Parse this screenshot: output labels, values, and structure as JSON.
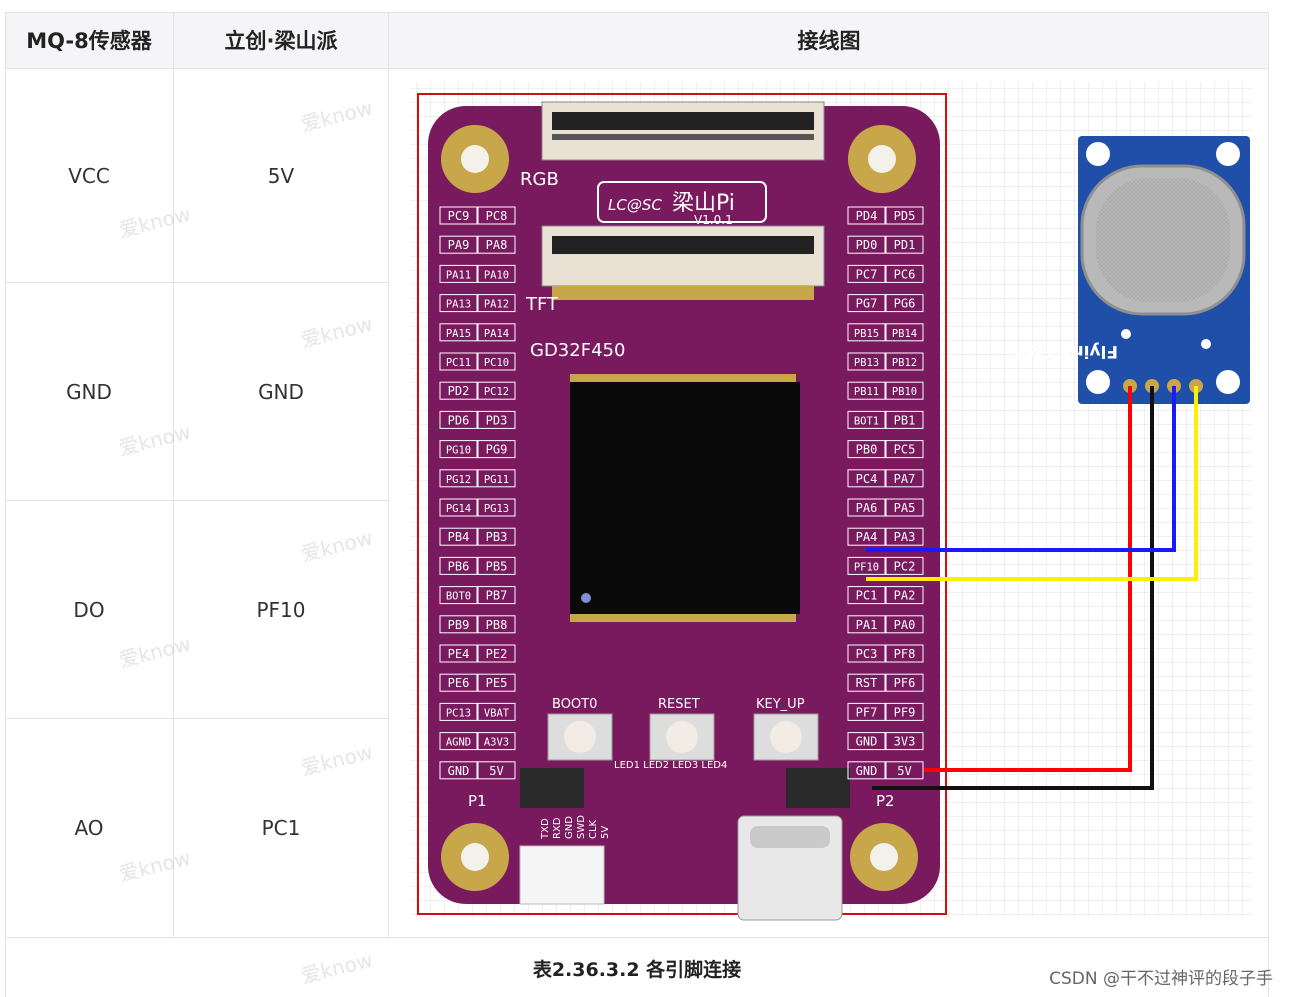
{
  "table": {
    "headers": [
      "MQ-8传感器",
      "立创·梁山派",
      "接线图"
    ],
    "rows": [
      {
        "sensor": "VCC",
        "board": "5V"
      },
      {
        "sensor": "GND",
        "board": "GND"
      },
      {
        "sensor": "DO",
        "board": "PF10"
      },
      {
        "sensor": "AO",
        "board": "PC1"
      }
    ]
  },
  "caption": "表2.36.3.2 各引脚连接",
  "credit": "CSDN @干不过神评的段子手",
  "watermark": "爱know",
  "diagram": {
    "board_brand": "LC@SC",
    "board_name": "梁山Pi",
    "board_version": "V1.0.1",
    "chip": "GD32F450",
    "label_rgb": "RGB",
    "label_tft": "TFT",
    "label_p1": "P1",
    "label_p2": "P2",
    "buttons": [
      "BOOT0",
      "RESET",
      "KEY_UP"
    ],
    "leds": "LED1 LED2 LED3 LED4",
    "sensor_label": "Flying-Fish",
    "debug_pins": [
      "TXD",
      "RXD",
      "GND",
      "SWD",
      "CLK",
      "5V"
    ],
    "left_pins": [
      [
        "PC9",
        "PC8"
      ],
      [
        "PA9",
        "PA8"
      ],
      [
        "PA11",
        "PA10"
      ],
      [
        "PA13",
        "PA12"
      ],
      [
        "PA15",
        "PA14"
      ],
      [
        "PC11",
        "PC10"
      ],
      [
        "PD2",
        "PC12"
      ],
      [
        "PD6",
        "PD3"
      ],
      [
        "PG10",
        "PG9"
      ],
      [
        "PG12",
        "PG11"
      ],
      [
        "PG14",
        "PG13"
      ],
      [
        "PB4",
        "PB3"
      ],
      [
        "PB6",
        "PB5"
      ],
      [
        "BOT0",
        "PB7"
      ],
      [
        "PB9",
        "PB8"
      ],
      [
        "PE4",
        "PE2"
      ],
      [
        "PE6",
        "PE5"
      ],
      [
        "PC13",
        "VBAT"
      ],
      [
        "AGND",
        "A3V3"
      ],
      [
        "GND",
        "5V"
      ]
    ],
    "right_pins": [
      [
        "PD4",
        "PD5"
      ],
      [
        "PD0",
        "PD1"
      ],
      [
        "PC7",
        "PC6"
      ],
      [
        "PG7",
        "PG6"
      ],
      [
        "PB15",
        "PB14"
      ],
      [
        "PB13",
        "PB12"
      ],
      [
        "PB11",
        "PB10"
      ],
      [
        "BOT1",
        "PB1"
      ],
      [
        "PB0",
        "PC5"
      ],
      [
        "PC4",
        "PA7"
      ],
      [
        "PA6",
        "PA5"
      ],
      [
        "PA4",
        "PA3"
      ],
      [
        "PF10",
        "PC2"
      ],
      [
        "PC1",
        "PA2"
      ],
      [
        "PA1",
        "PA0"
      ],
      [
        "PC3",
        "PF8"
      ],
      [
        "RST",
        "PF6"
      ],
      [
        "PF7",
        "PF9"
      ],
      [
        "GND",
        "3V3"
      ],
      [
        "GND",
        "5V"
      ]
    ],
    "colors": {
      "board": "#7a1a5e",
      "wire_vcc": "#ff0000",
      "wire_gnd": "#111111",
      "wire_do": "#1a1aff",
      "wire_ao": "#ffee00",
      "sensor_pcb": "#1f4fa8"
    }
  }
}
